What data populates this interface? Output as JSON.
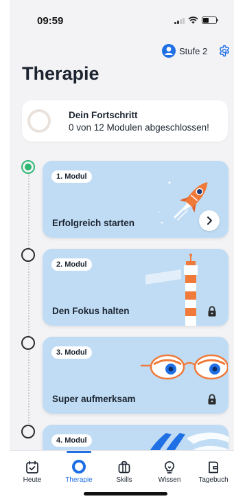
{
  "status_bar": {
    "time": "09:59"
  },
  "header": {
    "level_label": "Stufe 2",
    "user_icon": "user-circle-icon",
    "settings_icon": "gear-icon"
  },
  "page": {
    "title": "Therapie"
  },
  "progress": {
    "title": "Dein Fortschritt",
    "subtitle": "0 von 12 Modulen abgeschlossen!",
    "completed": 0,
    "total": 12
  },
  "modules": [
    {
      "badge": "1. Modul",
      "title": "Erfolgreich starten",
      "state": "current",
      "action_icon": "chevron-right-icon",
      "illustration": "rocket"
    },
    {
      "badge": "2. Modul",
      "title": "Den Fokus halten",
      "state": "locked",
      "action_icon": "lock-icon",
      "illustration": "lighthouse"
    },
    {
      "badge": "3. Modul",
      "title": "Super aufmerksam",
      "state": "locked",
      "action_icon": "lock-icon",
      "illustration": "glasses"
    },
    {
      "badge": "4. Modul",
      "title": "",
      "state": "locked",
      "illustration": "waves"
    }
  ],
  "tabbar": {
    "items": [
      {
        "label": "Heute",
        "icon": "calendar-check-icon"
      },
      {
        "label": "Therapie",
        "icon": "ring-icon",
        "active": true
      },
      {
        "label": "Skills",
        "icon": "briefcase-icon"
      },
      {
        "label": "Wissen",
        "icon": "lightbulb-icon"
      },
      {
        "label": "Tagebuch",
        "icon": "journal-icon"
      }
    ]
  },
  "colors": {
    "accent": "#1f6fe5",
    "card": "#bfdcf4",
    "done": "#2eb872",
    "text": "#1c2430",
    "illustration_orange": "#f07a3a"
  }
}
